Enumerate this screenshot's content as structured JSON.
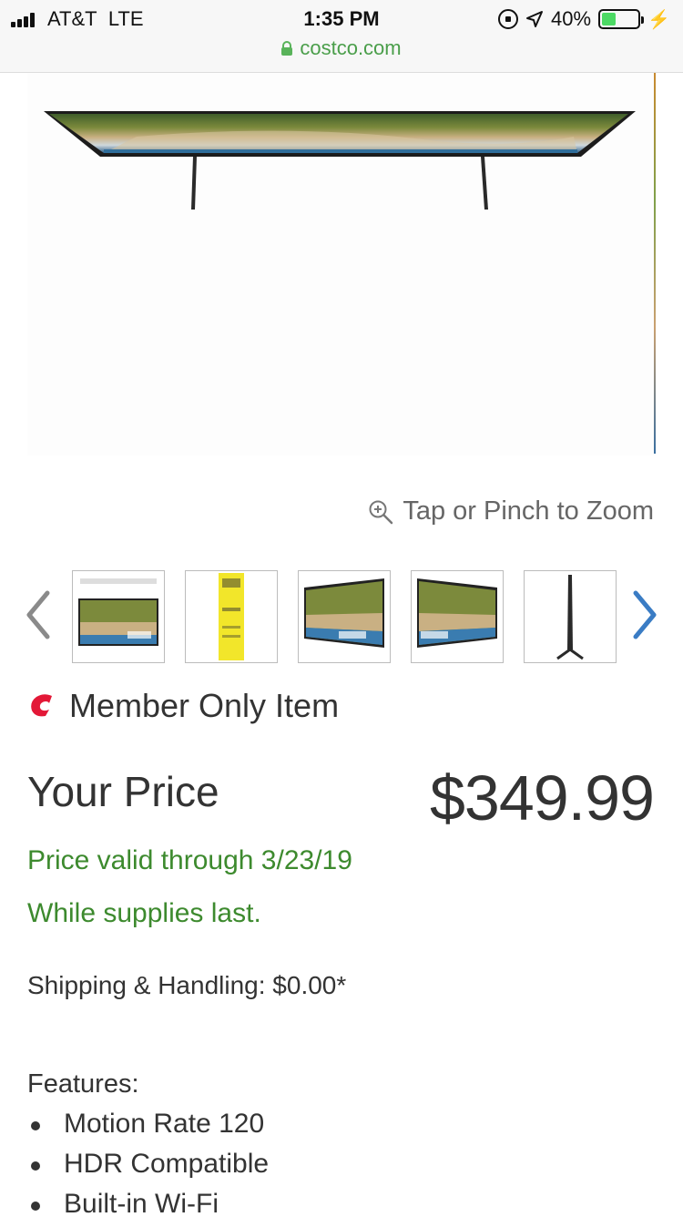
{
  "status_bar": {
    "carrier": "AT&T",
    "network": "LTE",
    "time": "1:35 PM",
    "battery_percent": "40%",
    "battery_level": 0.4,
    "icons": [
      "signal-icon",
      "rotation-lock-icon",
      "location-icon",
      "battery-icon",
      "charging-bolt-icon"
    ]
  },
  "browser": {
    "url": "costco.com"
  },
  "gallery": {
    "zoom_hint": "Tap or Pinch to Zoom",
    "thumbnails": [
      "tv-front-with-specs",
      "energy-guide-label",
      "tv-angled-left",
      "tv-angled-right",
      "tv-side-profile"
    ]
  },
  "product": {
    "member_badge": "Member Only Item",
    "price_label": "Your Price",
    "price": "$349.99",
    "price_valid": "Price valid through 3/23/19",
    "supplies": "While supplies last.",
    "shipping": "Shipping & Handling: $0.00*",
    "features_title": "Features:",
    "features": [
      "Motion Rate 120",
      "HDR Compatible",
      "Built-in Wi-Fi"
    ]
  },
  "colors": {
    "promo_green": "#3d8a2e",
    "url_green": "#4a9e4a",
    "nav_blue": "#3a7cc4",
    "costco_red": "#e31837"
  }
}
